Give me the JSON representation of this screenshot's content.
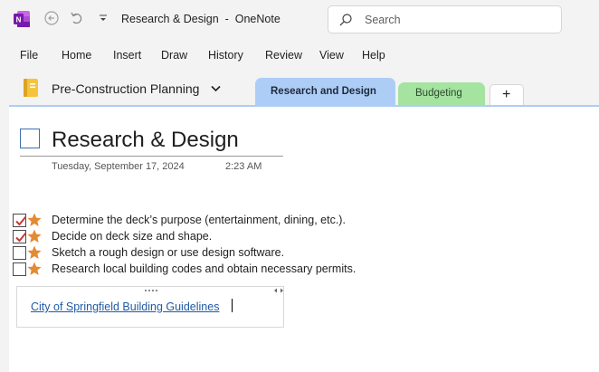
{
  "titlebar": {
    "app_icon": "onenote-logo",
    "title": "Research & Design  -  OneNote",
    "search_placeholder": "Search"
  },
  "menu": [
    "File",
    "Home",
    "Insert",
    "Draw",
    "History",
    "Review",
    "View",
    "Help"
  ],
  "notebook": {
    "name": "Pre-Construction Planning",
    "icon": "notebook-icon",
    "color": "#f5c43b"
  },
  "tabs": [
    {
      "label": "Research and Design",
      "active": true,
      "color": "#aecdf6"
    },
    {
      "label": "Budgeting",
      "active": false,
      "color": "#a5e3a0"
    },
    {
      "label": "+",
      "active": false
    }
  ],
  "page": {
    "title": "Research & Design",
    "date": "Tuesday, September 17, 2024",
    "time": "2:23 AM"
  },
  "todos": [
    {
      "text": "Determine the deck’s purpose (entertainment, dining, etc.).",
      "checked": true
    },
    {
      "text": "Decide on deck size and shape.",
      "checked": true
    },
    {
      "text": "Sketch a rough design or use design software.",
      "checked": false
    },
    {
      "text": "Research local building codes and obtain necessary permits.",
      "checked": false
    }
  ],
  "note": {
    "link_text": "City of Springfield Building Guidelines"
  },
  "colors": {
    "accent_link": "#1f5aa6",
    "check_red": "#c23b3b",
    "star_orange": "#e48a32",
    "onenote_purple": "#7719aa"
  }
}
